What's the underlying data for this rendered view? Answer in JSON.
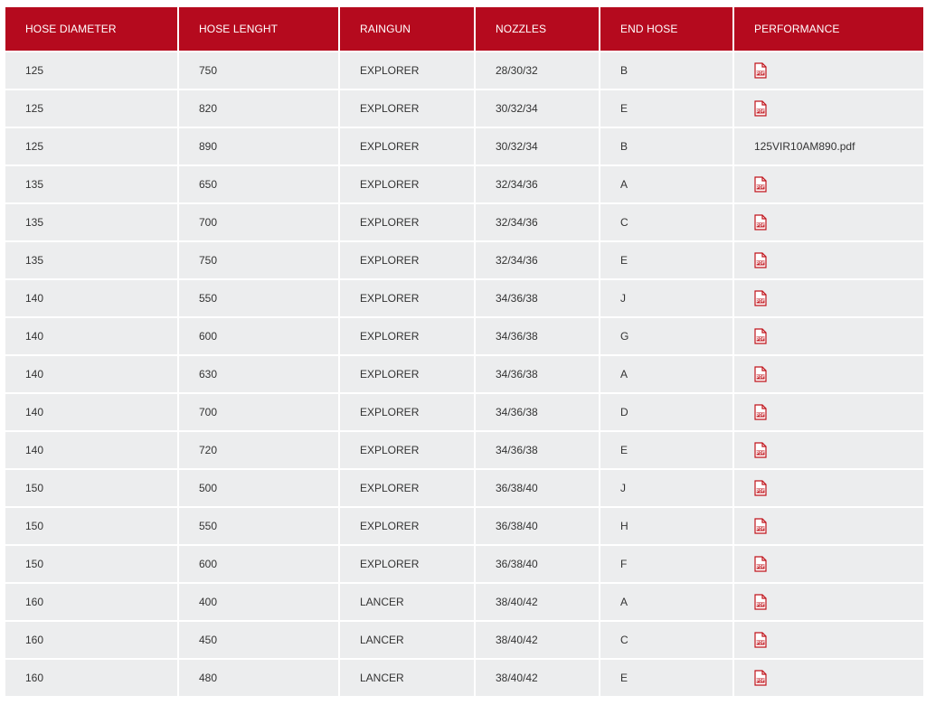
{
  "table": {
    "headers": [
      "HOSE DIAMETER",
      "HOSE LENGHT",
      "RAINGUN",
      "NOZZLES",
      "END HOSE",
      "PERFORMANCE"
    ],
    "rows": [
      {
        "diameter": "125",
        "length": "750",
        "raingun": "EXPLORER",
        "nozzles": "28/30/32",
        "end_hose": "B",
        "performance": {
          "type": "icon",
          "icon": "pdf-icon"
        }
      },
      {
        "diameter": "125",
        "length": "820",
        "raingun": "EXPLORER",
        "nozzles": "30/32/34",
        "end_hose": "E",
        "performance": {
          "type": "icon",
          "icon": "pdf-icon"
        }
      },
      {
        "diameter": "125",
        "length": "890",
        "raingun": "EXPLORER",
        "nozzles": "30/32/34",
        "end_hose": "B",
        "performance": {
          "type": "text",
          "text": "125VIR10AM890.pdf"
        }
      },
      {
        "diameter": "135",
        "length": "650",
        "raingun": "EXPLORER",
        "nozzles": "32/34/36",
        "end_hose": "A",
        "performance": {
          "type": "icon",
          "icon": "pdf-icon"
        }
      },
      {
        "diameter": "135",
        "length": "700",
        "raingun": "EXPLORER",
        "nozzles": "32/34/36",
        "end_hose": "C",
        "performance": {
          "type": "icon",
          "icon": "pdf-icon"
        }
      },
      {
        "diameter": "135",
        "length": "750",
        "raingun": "EXPLORER",
        "nozzles": "32/34/36",
        "end_hose": "E",
        "performance": {
          "type": "icon",
          "icon": "pdf-icon"
        }
      },
      {
        "diameter": "140",
        "length": "550",
        "raingun": "EXPLORER",
        "nozzles": "34/36/38",
        "end_hose": "J",
        "performance": {
          "type": "icon",
          "icon": "pdf-icon"
        }
      },
      {
        "diameter": "140",
        "length": "600",
        "raingun": "EXPLORER",
        "nozzles": "34/36/38",
        "end_hose": "G",
        "performance": {
          "type": "icon",
          "icon": "pdf-icon"
        }
      },
      {
        "diameter": "140",
        "length": "630",
        "raingun": "EXPLORER",
        "nozzles": "34/36/38",
        "end_hose": "A",
        "performance": {
          "type": "icon",
          "icon": "pdf-icon"
        }
      },
      {
        "diameter": "140",
        "length": "700",
        "raingun": "EXPLORER",
        "nozzles": "34/36/38",
        "end_hose": "D",
        "performance": {
          "type": "icon",
          "icon": "pdf-icon"
        }
      },
      {
        "diameter": "140",
        "length": "720",
        "raingun": "EXPLORER",
        "nozzles": "34/36/38",
        "end_hose": "E",
        "performance": {
          "type": "icon",
          "icon": "pdf-icon"
        }
      },
      {
        "diameter": "150",
        "length": "500",
        "raingun": "EXPLORER",
        "nozzles": "36/38/40",
        "end_hose": "J",
        "performance": {
          "type": "icon",
          "icon": "pdf-icon"
        }
      },
      {
        "diameter": "150",
        "length": "550",
        "raingun": "EXPLORER",
        "nozzles": "36/38/40",
        "end_hose": "H",
        "performance": {
          "type": "icon",
          "icon": "pdf-icon"
        }
      },
      {
        "diameter": "150",
        "length": "600",
        "raingun": "EXPLORER",
        "nozzles": "36/38/40",
        "end_hose": "F",
        "performance": {
          "type": "icon",
          "icon": "pdf-icon"
        }
      },
      {
        "diameter": "160",
        "length": "400",
        "raingun": "LANCER",
        "nozzles": "38/40/42",
        "end_hose": "A",
        "performance": {
          "type": "icon",
          "icon": "pdf-icon"
        }
      },
      {
        "diameter": "160",
        "length": "450",
        "raingun": "LANCER",
        "nozzles": "38/40/42",
        "end_hose": "C",
        "performance": {
          "type": "icon",
          "icon": "pdf-icon"
        }
      },
      {
        "diameter": "160",
        "length": "480",
        "raingun": "LANCER",
        "nozzles": "38/40/42",
        "end_hose": "E",
        "performance": {
          "type": "icon",
          "icon": "pdf-icon"
        }
      }
    ]
  },
  "colors": {
    "header_bg": "#b50a1e",
    "header_text": "#ffffff",
    "cell_bg": "#ecedee",
    "cell_text": "#333333",
    "pdf_icon": "#c0141c"
  }
}
